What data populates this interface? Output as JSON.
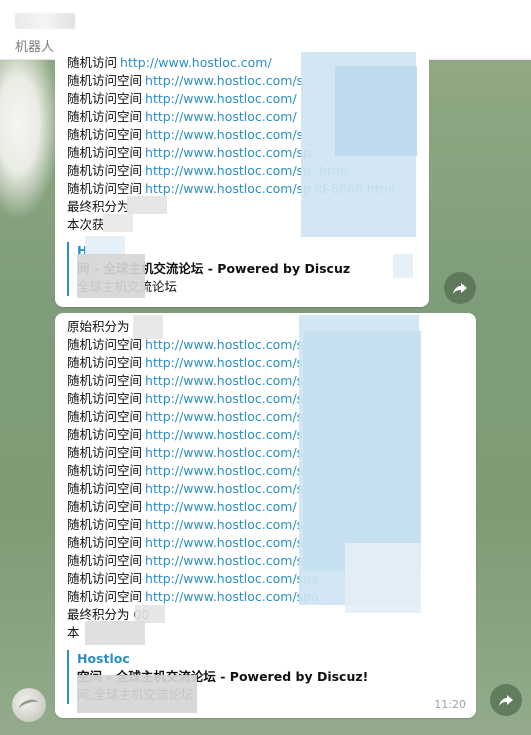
{
  "header": {
    "subtitle": "机器人"
  },
  "message1": {
    "lines": [
      {
        "label": "随机访问",
        "link": "http://www.hostloc.com/"
      },
      {
        "label": "随机访问空间",
        "link": "http://www.hostloc.com/s"
      },
      {
        "label": "随机访问空间",
        "link": "http://www.hostloc.com/"
      },
      {
        "label": "随机访问空间",
        "link": "http://www.hostloc.com/"
      },
      {
        "label": "随机访问空间",
        "link": "http://www.hostloc.com/s"
      },
      {
        "label": "随机访问空间",
        "link": "http://www.hostloc.com/sp"
      },
      {
        "label": "随机访问空间",
        "link": "http://www.hostloc.com/sp .html"
      },
      {
        "label": "随机访问空间",
        "link": "http://www.hostloc.com/sp id-8866.html"
      }
    ],
    "final_label": "最终积分为",
    "gain_label": "本次获",
    "preview": {
      "site": "H",
      "title": "间 - 全球主机交流论坛 - Powered by Discuz",
      "desc": "全球主机交流论坛"
    }
  },
  "message2": {
    "intro_label": "原始积分为",
    "lines": [
      {
        "label": "随机访问空间",
        "link": "http://www.hostloc.com/sp"
      },
      {
        "label": "随机访问空间",
        "link": "http://www.hostloc.com/s"
      },
      {
        "label": "随机访问空间",
        "link": "http://www.hostloc.com/s"
      },
      {
        "label": "随机访问空间",
        "link": "http://www.hostloc.com/s"
      },
      {
        "label": "随机访问空间",
        "link": "http://www.hostloc.com/s"
      },
      {
        "label": "随机访问空间",
        "link": "http://www.hostloc.com/s"
      },
      {
        "label": "随机访问空间",
        "link": "http://www.hostloc.com/s"
      },
      {
        "label": "随机访问空间",
        "link": "http://www.hostloc.com/s"
      },
      {
        "label": "随机访问空间",
        "link": "http://www.hostloc.com/s"
      },
      {
        "label": "随机访问空间",
        "link": "http://www.hostloc.com/"
      },
      {
        "label": "随机访问空间",
        "link": "http://www.hostloc.com/s"
      },
      {
        "label": "随机访问空间",
        "link": "http://www.hostloc.com/s"
      },
      {
        "label": "随机访问空间",
        "link": "http://www.hostloc.com/spa"
      },
      {
        "label": "随机访问空间",
        "link": "http://www.hostloc.com/spa"
      },
      {
        "label": "随机访问空间",
        "link": "http://www.hostloc.com/spa"
      }
    ],
    "final_label": "最终积分为 00",
    "gain_label": "本",
    "preview": {
      "site": "Hostloc",
      "title": "空间 - 全球主机交流论坛 - Powered by Discuz!",
      "desc": "间,全球主机交流论坛"
    },
    "time": "11:20"
  },
  "colors": {
    "link": "#2a8fc4",
    "bubble": "#ffffff",
    "background": "#7f9d7b"
  },
  "icons": {
    "share": "share-arrow-icon",
    "avatar": "bot-avatar"
  }
}
